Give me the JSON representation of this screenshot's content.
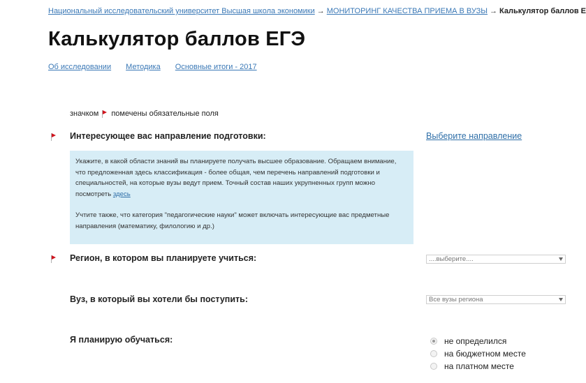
{
  "breadcrumb": {
    "item1": "Национальный исследовательский университет Высшая школа экономики",
    "sep1": "→",
    "item2": "МОНИТОРИНГ КАЧЕСТВА ПРИЕМА В ВУЗЫ",
    "sep2": "→",
    "current": "Калькулятор баллов ЕГЭ"
  },
  "page_title": "Калькулятор баллов ЕГЭ",
  "subnav": {
    "about": "Об исследовании",
    "method": "Методика",
    "results": "Основные итоги - 2017"
  },
  "required_note": {
    "before": "значком",
    "after": "помечены обязательные поля"
  },
  "direction": {
    "label": "Интересующее вас направление подготовки:",
    "link": "Выберите направление"
  },
  "info": {
    "p1": "Укажите, в какой области знаний вы планируете получать высшее образование. Обращаем внимание, что предложенная здесь классификация - более общая, чем перечень направлений подготовки и специальностей, на которые вузы ведут прием. Точный состав наших укрупненных групп можно посмотреть",
    "p1_link": "здесь",
    "p2": "Учтите также, что категория \"педагогические науки\" может включать интересующие вас предметные направления (математику, филологию и др.)"
  },
  "region": {
    "label": "Регион, в котором вы планируете учиться:",
    "select_value": "....выберите...."
  },
  "university": {
    "label": "Вуз, в который вы хотели бы поступить:",
    "select_value": "Все вузы региона"
  },
  "study": {
    "label": "Я планирую обучаться:",
    "options": [
      "не определился",
      "на бюджетном месте",
      "на платном месте"
    ],
    "selected": "не определился"
  },
  "colors": {
    "link": "#3a78b6",
    "flag": "#d0141e",
    "info_bg": "#d7edf6"
  }
}
